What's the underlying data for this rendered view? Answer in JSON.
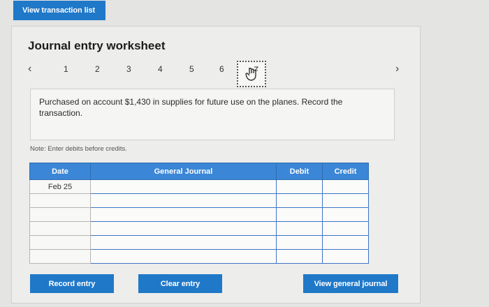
{
  "header": {
    "view_transaction_list": "View transaction list"
  },
  "worksheet": {
    "title": "Journal entry worksheet",
    "nav": {
      "prev_icon": "chevron-left-icon",
      "next_icon": "chevron-right-icon",
      "pages": [
        "1",
        "2",
        "3",
        "4",
        "5",
        "6"
      ],
      "current_icon": "pointer-hand-icon"
    },
    "description": "Purchased on account $1,430 in supplies for future use on the planes. Record the transaction.",
    "note": "Note: Enter debits before credits."
  },
  "table": {
    "headers": {
      "date": "Date",
      "journal": "General Journal",
      "debit": "Debit",
      "credit": "Credit"
    },
    "rows": [
      {
        "date": "Feb 25",
        "journal": "",
        "debit": "",
        "credit": ""
      },
      {
        "date": "",
        "journal": "",
        "debit": "",
        "credit": ""
      },
      {
        "date": "",
        "journal": "",
        "debit": "",
        "credit": ""
      },
      {
        "date": "",
        "journal": "",
        "debit": "",
        "credit": ""
      },
      {
        "date": "",
        "journal": "",
        "debit": "",
        "credit": ""
      },
      {
        "date": "",
        "journal": "",
        "debit": "",
        "credit": ""
      }
    ]
  },
  "buttons": {
    "record": "Record entry",
    "clear": "Clear entry",
    "view_journal": "View general journal"
  },
  "colors": {
    "accent": "#1f78c8",
    "header": "#3b86d6",
    "background": "#e4e4e2"
  }
}
